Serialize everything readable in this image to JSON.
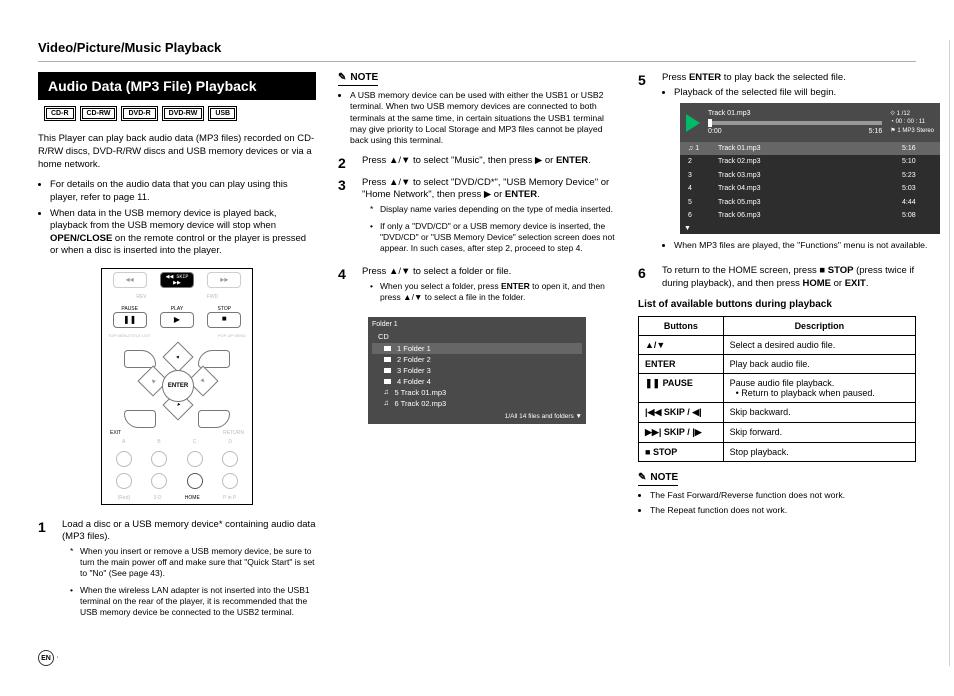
{
  "page_header": "Video/Picture/Music Playback",
  "section_head": "Audio Data (MP3 File) Playback",
  "badges": [
    "CD-R",
    "CD-RW",
    "DVD-R",
    "DVD-RW",
    "USB"
  ],
  "intro": "This Player can play back audio data (MP3 files) recorded on CD-R/RW discs, DVD-R/RW discs and USB memory devices or via a home network.",
  "intro_bullets": [
    "For details on the audio data that you can play using this player, refer to page 11.",
    "When data in the USB memory device is played back, playback from the USB memory device will stop when OPEN/CLOSE on the remote control or the player is pressed or when a disc is inserted into the player."
  ],
  "remote_labels": {
    "skip_back": "◄◄",
    "skip_fwd": "►►",
    "rev": "REV",
    "fwd": "FWD",
    "pause": "PAUSE",
    "play": "PLAY",
    "stop": "STOP",
    "enter": "ENTER",
    "top_menu": "TOP MENU/TITLE LIST",
    "popup": "POP-UP MENU",
    "exit": "EXIT",
    "return": "RETURN",
    "home": "HOME",
    "a": "A",
    "b": "B",
    "c": "C",
    "d": "D",
    "rec": "(Red)",
    "three_d": "3-D",
    "pin": "P in P"
  },
  "step1": {
    "text": "Load a disc or a USB memory device* containing audio data (MP3 files).",
    "subs": [
      "When you insert or remove a USB memory device, be sure to turn the main power off and make sure that \"Quick Start\" is set to \"No\" (See page 43).",
      "When the wireless LAN adapter is not inserted into the USB1 terminal on the rear of the player, it is recommended that the USB memory device be connected to the USB2 terminal."
    ]
  },
  "note1_label": "NOTE",
  "note1_bullets": [
    "A USB memory device can be used with either the USB1 or USB2 terminal. When two USB memory devices are connected to both terminals at the same time, in certain situations the USB1 terminal may give priority to Local Storage and MP3 files cannot be played back using this terminal."
  ],
  "step2": "Press ▲/▼ to select \"Music\", then press ▶ or ENTER.",
  "step3": {
    "text": "Press ▲/▼ to select \"DVD/CD*\", \"USB Memory Device\" or \"Home Network\", then press ▶ or ENTER.",
    "subs_star": "Display name varies depending on the type of media inserted.",
    "subs_dot": "If only a \"DVD/CD\" or a USB memory device is inserted, the \"DVD/CD\" or \"USB Memory Device\" selection screen does not appear. In such cases, after step 2, proceed to step 4."
  },
  "step4": {
    "text": "Press ▲/▼ to select a folder or file.",
    "sub_dot": "When you select a folder, press ENTER to open it, and then press ▲/▼ to select a file in the folder."
  },
  "folder_panel": {
    "title": "Folder 1",
    "sub": "CD",
    "rows": [
      {
        "icon": "folder",
        "label": "1 Folder 1"
      },
      {
        "icon": "folder",
        "label": "2 Folder 2"
      },
      {
        "icon": "folder",
        "label": "3 Folder 3"
      },
      {
        "icon": "folder",
        "label": "4 Folder 4"
      },
      {
        "icon": "note",
        "label": "5 Track 01.mp3"
      },
      {
        "icon": "note",
        "label": "6 Track 02.mp3"
      }
    ],
    "footer": "1/All 14 files and folders  ▼"
  },
  "step5": {
    "line1": "Press ENTER to play back the selected file.",
    "bullet": "Playback of the selected file will begin."
  },
  "playback": {
    "track": "Track 01.mp3",
    "pos": "0:00",
    "len": "5:16",
    "counter": "1 /12",
    "elapsed": "00 : 00 : 11",
    "rate": "1   MP3 Stereo",
    "rows": [
      {
        "n": "1",
        "name": "Track 01.mp3",
        "t": "5:16",
        "sel": true
      },
      {
        "n": "2",
        "name": "Track 02.mp3",
        "t": "5:10"
      },
      {
        "n": "3",
        "name": "Track 03.mp3",
        "t": "5:23"
      },
      {
        "n": "4",
        "name": "Track 04.mp3",
        "t": "5:03"
      },
      {
        "n": "5",
        "name": "Track 05.mp3",
        "t": "4:44"
      },
      {
        "n": "6",
        "name": "Track 06.mp3",
        "t": "5:08"
      }
    ]
  },
  "step5_note": "When MP3 files are played, the \"Functions\" menu is not available.",
  "step6": "To return to the HOME screen, press ■ STOP (press twice if during playback), and then press HOME or EXIT.",
  "table_title": "List of available buttons during playback",
  "table": {
    "headers": [
      "Buttons",
      "Description"
    ],
    "rows": [
      {
        "b": "▲/▼",
        "d": [
          "Select a desired audio file."
        ]
      },
      {
        "b": "ENTER",
        "d": [
          "Play back audio file."
        ]
      },
      {
        "b": "❚❚ PAUSE",
        "d": [
          "Pause audio file playback.",
          "• Return to playback when paused."
        ]
      },
      {
        "b": "|◀◀ SKIP / ◀|",
        "d": [
          "Skip backward."
        ]
      },
      {
        "b": "▶▶| SKIP / |▶",
        "d": [
          "Skip forward."
        ]
      },
      {
        "b": "■ STOP",
        "d": [
          "Stop playback."
        ]
      }
    ]
  },
  "note2_bullets": [
    "The Fast Forward/Reverse function does not work.",
    "The Repeat function does not work."
  ],
  "page_mark": "EN"
}
